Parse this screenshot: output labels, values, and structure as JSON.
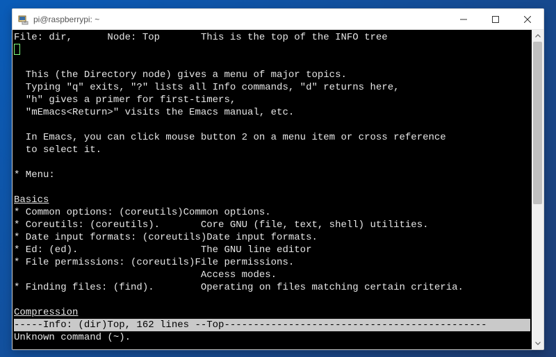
{
  "window": {
    "title": "pi@raspberrypi: ~",
    "icon_name": "putty-icon"
  },
  "terminal": {
    "header": "File: dir,      Node: Top       This is the top of the INFO tree",
    "body_lines": [
      "",
      "  This (the Directory node) gives a menu of major topics.",
      "  Typing \"q\" exits, \"?\" lists all Info commands, \"d\" returns here,",
      "  \"h\" gives a primer for first-timers,",
      "  \"mEmacs<Return>\" visits the Emacs manual, etc.",
      "",
      "  In Emacs, you can click mouse button 2 on a menu item or cross reference",
      "  to select it.",
      "",
      "* Menu:"
    ],
    "section1_title": "Basics",
    "section1_lines": [
      "* Common options: (coreutils)Common options.",
      "* Coreutils: (coreutils).       Core GNU (file, text, shell) utilities.",
      "* Date input formats: (coreutils)Date input formats.",
      "* Ed: (ed).                     The GNU line editor",
      "* File permissions: (coreutils)File permissions.",
      "                                Access modes.",
      "* Finding files: (find).        Operating on files matching certain criteria."
    ],
    "section2_title": "Compression",
    "status_line": "-----Info: (dir)Top, 162 lines --Top---------------------------------------------",
    "echo_line": "Unknown command (~)."
  }
}
